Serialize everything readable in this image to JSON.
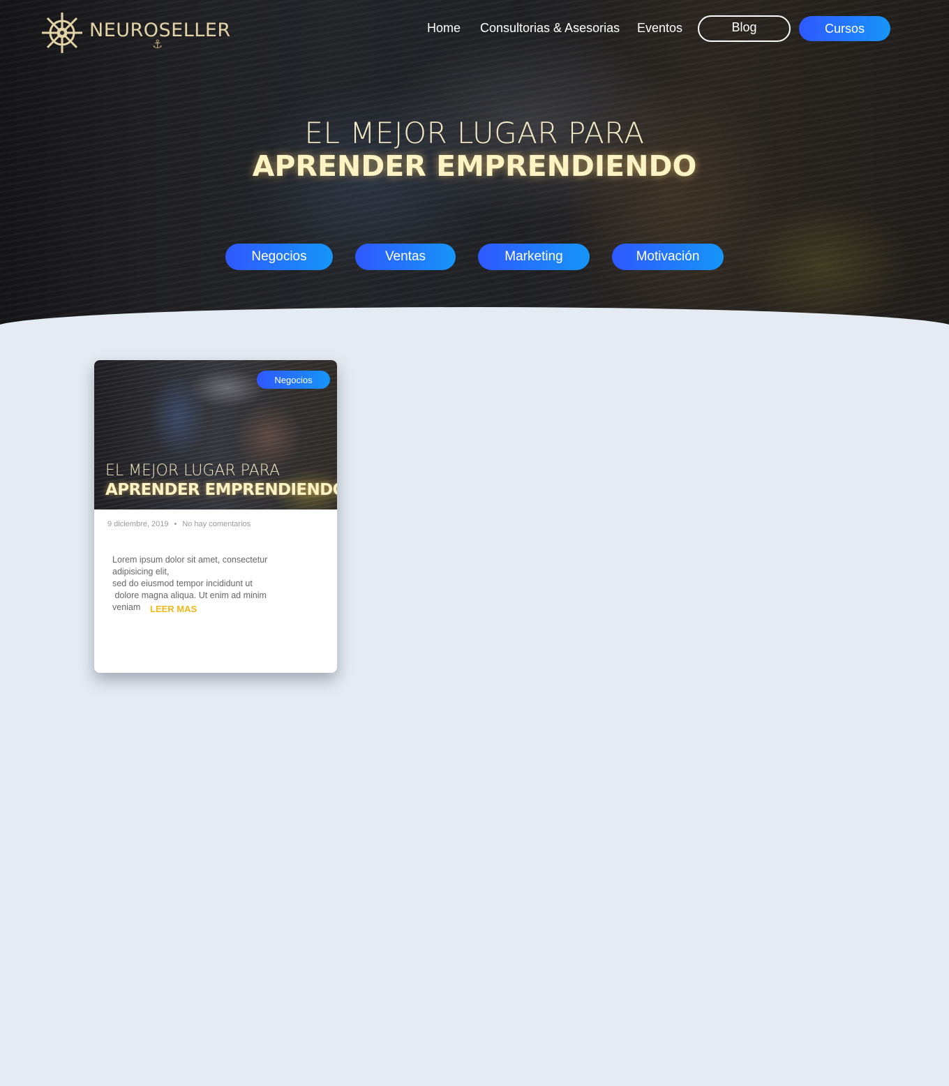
{
  "brand": {
    "logo_text": "NEUROSELLER"
  },
  "nav": {
    "links": [
      "Home",
      "Consultorias & Asesorias",
      "Eventos"
    ],
    "blog_label": "Blog",
    "cursos_label": "Cursos"
  },
  "hero": {
    "line1": "EL MEJOR LUGAR PARA",
    "line2": "APRENDER EMPRENDIENDO",
    "categories": [
      "Negocios",
      "Ventas",
      "Marketing",
      "Motivación"
    ]
  },
  "post": {
    "category": "Negocios",
    "image_line1": "EL MEJOR LUGAR PARA",
    "image_line2": "APRENDER EMPRENDIENDO",
    "date": "9 diciembre, 2019",
    "comments": "No hay comentarios",
    "excerpt": [
      "Lorem ipsum dolor sit amet, consectetur",
      "adipisicing elit,",
      "sed do eiusmod tempor incididunt ut",
      " dolore magna aliqua. Ut enim ad minim",
      "veniam"
    ],
    "read_more": "LEER MAS"
  },
  "colors": {
    "accent_start": "#2f58ff",
    "accent_end": "#1695f7",
    "gold": "#f0b817",
    "page_bg": "#e4ebf2"
  }
}
